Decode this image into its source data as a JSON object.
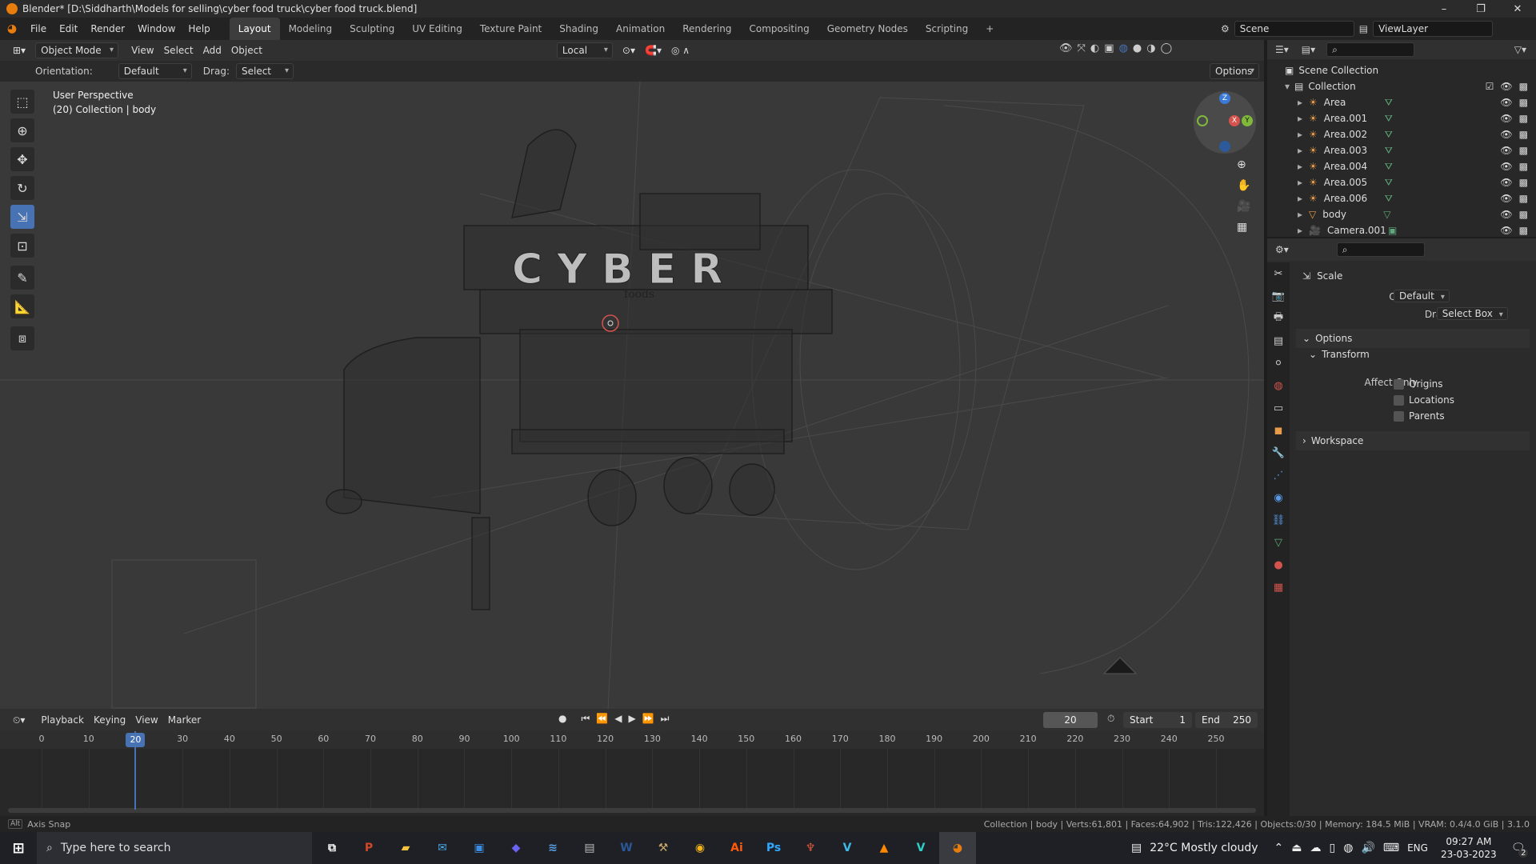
{
  "window": {
    "title": "Blender* [D:\\Siddharth\\Models for selling\\cyber food truck\\cyber food truck.blend]",
    "controls": [
      "–",
      "❐",
      "✕"
    ]
  },
  "menubar": {
    "menus": [
      "File",
      "Edit",
      "Render",
      "Window",
      "Help"
    ],
    "workspaces": [
      "Layout",
      "Modeling",
      "Sculpting",
      "UV Editing",
      "Texture Paint",
      "Shading",
      "Animation",
      "Rendering",
      "Compositing",
      "Geometry Nodes",
      "Scripting"
    ],
    "active_workspace": "Layout",
    "add_tab": "+",
    "scene": "Scene",
    "view_layer": "ViewLayer"
  },
  "viewport_header": {
    "mode": "Object Mode",
    "menus": [
      "View",
      "Select",
      "Add",
      "Object"
    ],
    "transform_orientation": "Local",
    "orientation_label": "Orientation:",
    "orientation_value": "Default",
    "drag_label": "Drag:",
    "drag_value": "Select Box",
    "options_label": "Options"
  },
  "viewport": {
    "perspective_label": "User Perspective",
    "collection_label": "(20) Collection | body",
    "model_sign_text": "CYBER",
    "model_sub_text": "foods",
    "gizmo_axes": [
      "Z",
      "X",
      "Y"
    ]
  },
  "toolbar": {
    "tools": [
      "select-box",
      "cursor",
      "move",
      "rotate",
      "scale",
      "transform",
      "annotate",
      "measure",
      "add-cube"
    ],
    "active_tool": "scale"
  },
  "outliner": {
    "scene_collection": "Scene Collection",
    "collection": "Collection",
    "items": [
      {
        "name": "Area",
        "type": "light"
      },
      {
        "name": "Area.001",
        "type": "light"
      },
      {
        "name": "Area.002",
        "type": "light"
      },
      {
        "name": "Area.003",
        "type": "light"
      },
      {
        "name": "Area.004",
        "type": "light"
      },
      {
        "name": "Area.005",
        "type": "light"
      },
      {
        "name": "Area.006",
        "type": "light"
      },
      {
        "name": "body",
        "type": "mesh"
      },
      {
        "name": "Camera.001",
        "type": "camera"
      }
    ]
  },
  "properties": {
    "tool_name": "Scale",
    "orientation_label": "Orientation",
    "orientation_value": "Default",
    "drag_label": "Drag:",
    "drag_value": "Select Box",
    "options_panel": "Options",
    "transform_panel": "Transform",
    "affect_only_label": "Affect Only",
    "checkboxes": [
      "Origins",
      "Locations",
      "Parents"
    ],
    "workspace_panel": "Workspace"
  },
  "timeline": {
    "menus": [
      "Playback",
      "Keying",
      "View",
      "Marker"
    ],
    "current_frame": "20",
    "start_label": "Start",
    "start_value": "1",
    "end_label": "End",
    "end_value": "250",
    "ruler": [
      0,
      10,
      20,
      30,
      40,
      50,
      60,
      70,
      80,
      90,
      100,
      110,
      120,
      130,
      140,
      150,
      160,
      170,
      180,
      190,
      200,
      210,
      220,
      230,
      240,
      250
    ],
    "playhead_frame": 20
  },
  "statusbar": {
    "left_key": "Alt",
    "left_text": "Axis Snap",
    "right_text": "Collection | body | Verts:61,801 | Faces:64,902 | Tris:122,426 | Objects:0/30 | Memory: 184.5 MiB | VRAM: 0.4/4.0 GiB | 3.1.0"
  },
  "taskbar": {
    "search_placeholder": "Type here to search",
    "apps": [
      {
        "name": "task-view",
        "glyph": "⧉",
        "color": "#ffffff"
      },
      {
        "name": "powerpoint",
        "glyph": "P",
        "color": "#d24726"
      },
      {
        "name": "file-explorer",
        "glyph": "▰",
        "color": "#f8c33d"
      },
      {
        "name": "mail",
        "glyph": "✉",
        "color": "#4aa8e8"
      },
      {
        "name": "store",
        "glyph": "▣",
        "color": "#3a8de0"
      },
      {
        "name": "app-blue",
        "glyph": "◆",
        "color": "#6a63f0"
      },
      {
        "name": "app-note",
        "glyph": "≋",
        "color": "#5aa0e8"
      },
      {
        "name": "app-gray",
        "glyph": "▤",
        "color": "#bbbbbb"
      },
      {
        "name": "word",
        "glyph": "W",
        "color": "#2b5797"
      },
      {
        "name": "app-tools",
        "glyph": "⚒",
        "color": "#c9a86a"
      },
      {
        "name": "chrome",
        "glyph": "◉",
        "color": "#f2b21b"
      },
      {
        "name": "illustrator",
        "glyph": "Ai",
        "color": "#ff5a0a"
      },
      {
        "name": "photoshop",
        "glyph": "Ps",
        "color": "#31a8ff"
      },
      {
        "name": "app-fox",
        "glyph": "♆",
        "color": "#e05a3a"
      },
      {
        "name": "app-v1",
        "glyph": "V",
        "color": "#3fb8e8"
      },
      {
        "name": "vlc",
        "glyph": "▲",
        "color": "#ff8800"
      },
      {
        "name": "app-v2",
        "glyph": "V",
        "color": "#2fd0c8"
      },
      {
        "name": "blender",
        "glyph": "◕",
        "color": "#e87d0d"
      }
    ],
    "weather": "22°C  Mostly cloudy",
    "language": "ENG",
    "time": "09:27 AM",
    "date": "23-03-2023",
    "notifications": "2"
  },
  "colors": {
    "accent": "#4772b3",
    "blender_orange": "#e87d0d",
    "light_icon": "#e89c4a",
    "data_green": "#5fa77a"
  }
}
